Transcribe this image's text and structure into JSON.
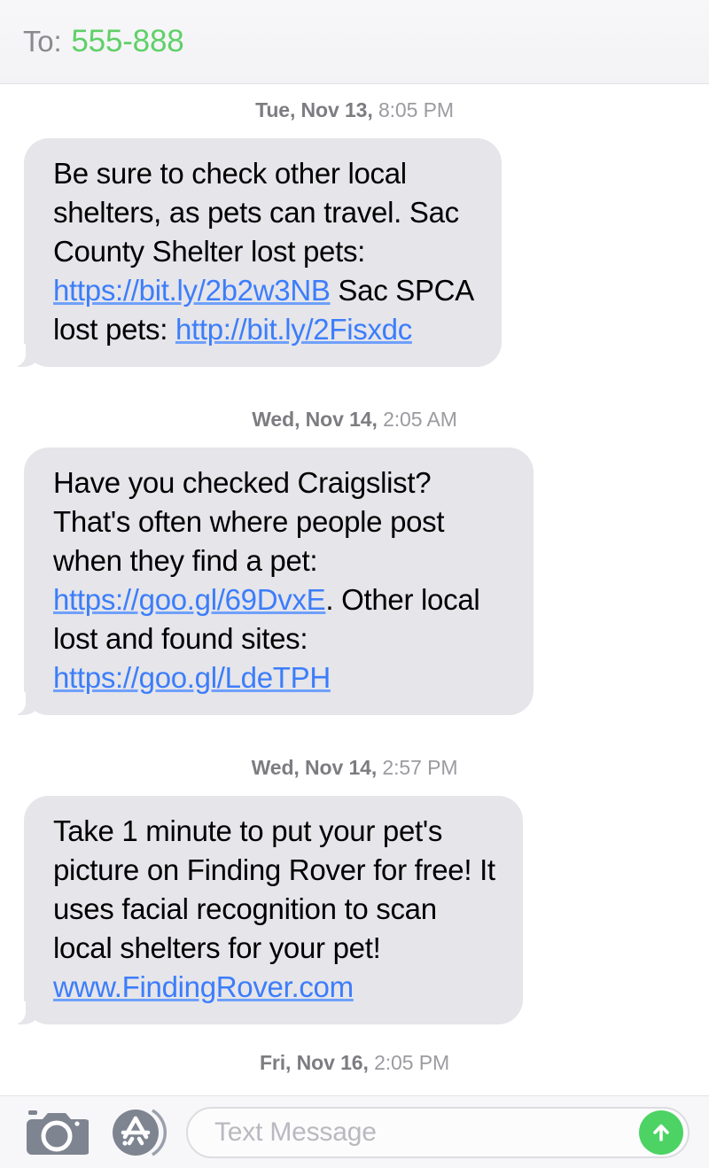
{
  "header": {
    "to_label": "To:",
    "recipient": "555-888",
    "recipient_color": "#5fd068"
  },
  "conversation": {
    "items": [
      {
        "kind": "timestamp",
        "date": "Tue, Nov 13,",
        "time": "8:05 PM"
      },
      {
        "kind": "message",
        "direction": "incoming",
        "segments": [
          {
            "type": "text",
            "value": "Be sure to check other local shelters, as pets can travel. Sac County Shelter lost pets: "
          },
          {
            "type": "link",
            "value": "https://bit.ly/2b2w3NB"
          },
          {
            "type": "text",
            "value": " Sac SPCA lost pets: "
          },
          {
            "type": "link",
            "value": "http://bit.ly/2Fisxdc"
          }
        ]
      },
      {
        "kind": "timestamp",
        "date": "Wed, Nov 14,",
        "time": "2:05 AM"
      },
      {
        "kind": "message",
        "direction": "incoming",
        "segments": [
          {
            "type": "text",
            "value": "Have you checked Craigslist? That's often where people post when they find a pet: "
          },
          {
            "type": "link",
            "value": "https://goo.gl/69DvxE"
          },
          {
            "type": "text",
            "value": ". Other local lost and found sites: "
          },
          {
            "type": "link",
            "value": "https://goo.gl/LdeTPH"
          }
        ]
      },
      {
        "kind": "timestamp",
        "date": "Wed, Nov 14,",
        "time": "2:57 PM"
      },
      {
        "kind": "message",
        "direction": "incoming",
        "segments": [
          {
            "type": "text",
            "value": "Take 1 minute to put your pet's picture on Finding Rover for free! It uses facial recognition to scan local shelters for your pet! "
          },
          {
            "type": "link",
            "value": "www.FindingRover.com"
          }
        ]
      },
      {
        "kind": "timestamp",
        "date": "Fri, Nov 16,",
        "time": "2:05 PM"
      }
    ]
  },
  "input_bar": {
    "camera_icon": "camera-icon",
    "appstore_icon": "app-store-icon",
    "placeholder": "Text Message",
    "send_icon": "arrow-up-icon",
    "send_color": "#4cd364"
  }
}
